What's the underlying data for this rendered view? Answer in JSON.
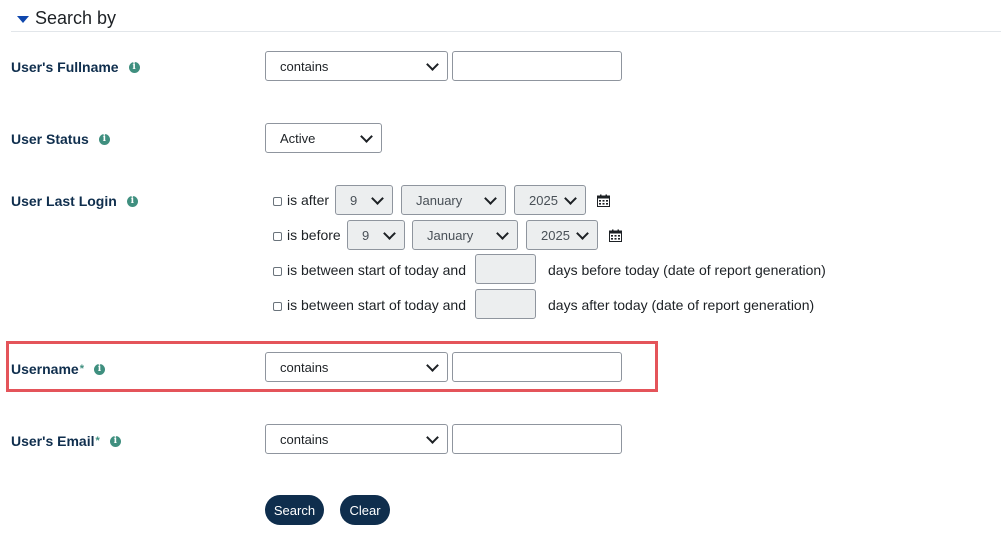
{
  "section": {
    "title": "Search by"
  },
  "fields": {
    "fullname": {
      "label": "User's Fullname",
      "operator": "contains",
      "value": ""
    },
    "status": {
      "label": "User Status",
      "value": "Active"
    },
    "last_login": {
      "label": "User Last Login",
      "after": {
        "text": "is after",
        "day": "9",
        "month": "January",
        "year": "2025"
      },
      "before": {
        "text": "is before",
        "day": "9",
        "month": "January",
        "year": "2025"
      },
      "between_before": {
        "text_start": "is between start of today and",
        "text_end": "days before today (date of report generation)"
      },
      "between_after": {
        "text_start": "is between start of today and",
        "text_end": "days after today (date of report generation)"
      }
    },
    "username": {
      "label": "Username",
      "required_mark": "*",
      "operator": "contains",
      "value": ""
    },
    "email": {
      "label": "User's Email",
      "required_mark": "*",
      "operator": "contains",
      "value": ""
    }
  },
  "icons": {
    "info": "i"
  },
  "buttons": {
    "search": "Search",
    "clear": "Clear"
  },
  "colors": {
    "accent": "#0f2e4d",
    "info": "#3f8f7f",
    "highlight": "#e4545a"
  }
}
